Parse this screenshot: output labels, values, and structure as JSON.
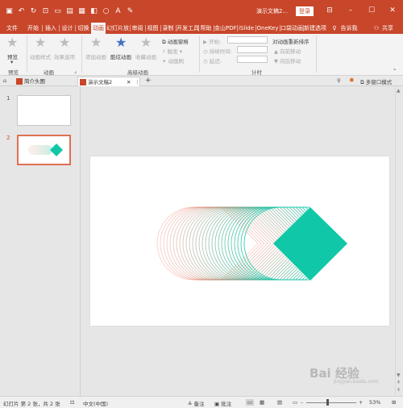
{
  "titlebar": {
    "doc_title": "演示文稿2...",
    "login_label": "登录",
    "qat_icons": [
      "save-icon",
      "undo-icon",
      "redo-icon",
      "start-icon",
      "new-icon",
      "open-icon",
      "print-icon",
      "format-icon",
      "shape-icon",
      "font-icon",
      "draw-icon"
    ]
  },
  "tabs": [
    "文件",
    "开始",
    "插入",
    "设计",
    "切换",
    "动画",
    "幻灯片放",
    "审阅",
    "视图",
    "录制",
    "开发工具",
    "帮助",
    "金山PDF",
    "iSlide",
    "OneKey",
    "口袋动画",
    "新建选项",
    "告诉我",
    "共享"
  ],
  "active_tab": "动画",
  "ribbon": {
    "preview": "预览",
    "preview_group": "预览",
    "anim_style": "动画样式",
    "effect_options": "效果选项",
    "anim_group": "动画",
    "add_anim": "添加动画",
    "painter": "酷炫动画",
    "pane": "动画窗格",
    "trigger": "触发",
    "anim_brush": "动画刷",
    "advanced_group": "高级动画",
    "collect": "收藏动画",
    "start": "开始:",
    "duration": "持续时间:",
    "delay": "延迟:",
    "reorder": "对动画重新排序",
    "move_earlier": "向前移动",
    "move_later": "向后移动",
    "timing_group": "计时"
  },
  "doc_tabs": {
    "tab1": "简介头图",
    "tab2": "演示文稿2",
    "close": "✕",
    "add": "+",
    "multi_window": "多窗口模式"
  },
  "slides": {
    "items": [
      {
        "num": "1"
      },
      {
        "num": "2"
      }
    ],
    "selected": "2"
  },
  "status": {
    "slide_info": "幻灯片 第 2 张，共 2 张",
    "language": "中文(中国)",
    "notes": "备注",
    "comments": "批注",
    "zoom": "53%"
  },
  "watermark": {
    "main": "Bai 经验",
    "sub": "jingyan.baidu.com"
  },
  "colors": {
    "accent": "#c8462a",
    "shape_start": "#f47a66",
    "shape_end": "#10c8a8"
  }
}
